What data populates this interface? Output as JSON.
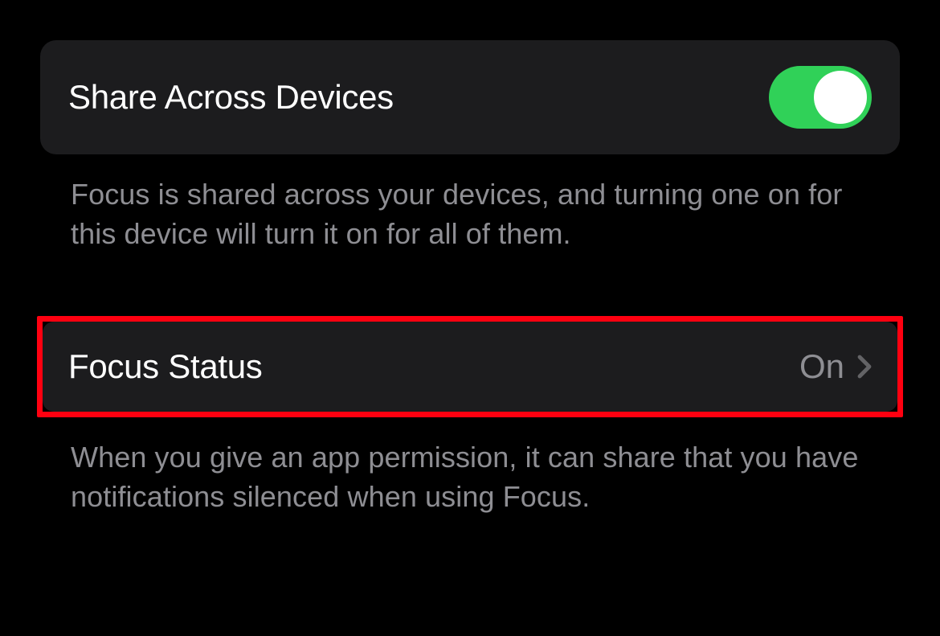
{
  "share_devices": {
    "label": "Share Across Devices",
    "enabled": true,
    "footer": "Focus is shared across your devices, and turning one on for this device will turn it on for all of them."
  },
  "focus_status": {
    "label": "Focus Status",
    "value": "On",
    "footer": "When you give an app permission, it can share that you have notifications silenced when using Focus."
  },
  "highlight_color": "#ff0010",
  "toggle_on_color": "#30d158"
}
